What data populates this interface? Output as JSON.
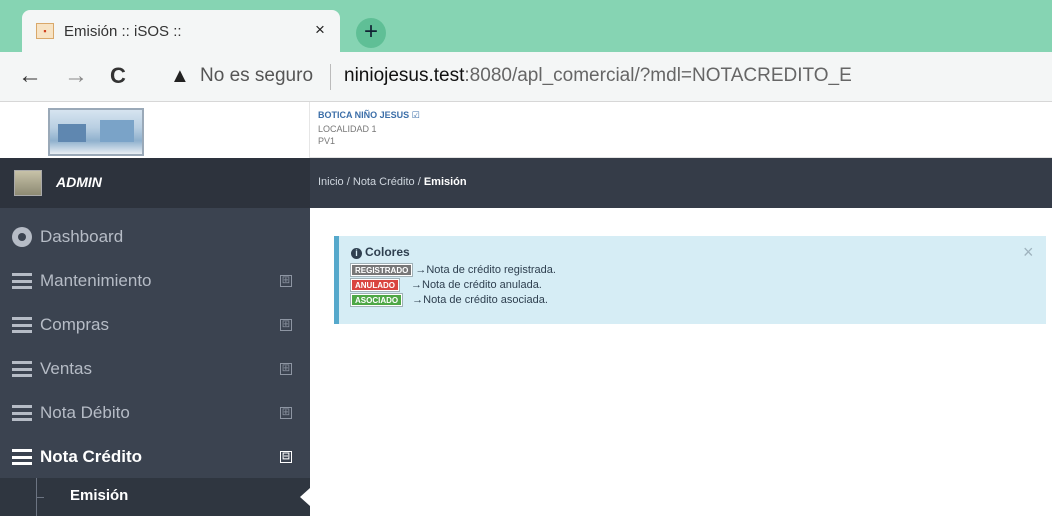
{
  "browser": {
    "tab_title": "Emisión :: iSOS ::",
    "tab_close": "×",
    "new_tab": "+",
    "back": "←",
    "forward": "→",
    "reload": "C",
    "warning_icon": "▲",
    "security_label": "No es seguro",
    "url_host": "niniojesus.test",
    "url_rest": ":8080/apl_comercial/?mdl=NOTACREDITO_E"
  },
  "header": {
    "company_name": "BOTICA NIÑO JESUS ☑",
    "locality": "LOCALIDAD 1",
    "point_of_sale": "PV1"
  },
  "user": {
    "name": "ADMIN"
  },
  "breadcrumb": {
    "home": "Inicio",
    "sep": "/",
    "section": "Nota Crédito",
    "current": "Emisión"
  },
  "sidebar": {
    "expand_symbol": "⊞",
    "collapse_symbol": "⊟",
    "items": [
      {
        "label": "Dashboard",
        "icon": "dashboard-icon"
      },
      {
        "label": "Mantenimiento",
        "icon": "list-icon"
      },
      {
        "label": "Compras",
        "icon": "list-icon"
      },
      {
        "label": "Ventas",
        "icon": "list-icon"
      },
      {
        "label": "Nota Débito",
        "icon": "list-icon"
      },
      {
        "label": "Nota Crédito",
        "icon": "list-icon",
        "active": true
      }
    ],
    "sub_items": [
      {
        "label": "Emisión"
      }
    ]
  },
  "alert": {
    "info_icon": "i",
    "title": "Colores",
    "close": "×",
    "legend": [
      {
        "badge": "REGISTRADO",
        "text": "→Nota de crédito registrada.",
        "color": "#777777"
      },
      {
        "badge": "ANULADO",
        "text": "→Nota de crédito anulada.",
        "color": "#d9443f"
      },
      {
        "badge": "ASOCIADO",
        "text": "→Nota de crédito asociada.",
        "color": "#4ea746"
      }
    ]
  }
}
